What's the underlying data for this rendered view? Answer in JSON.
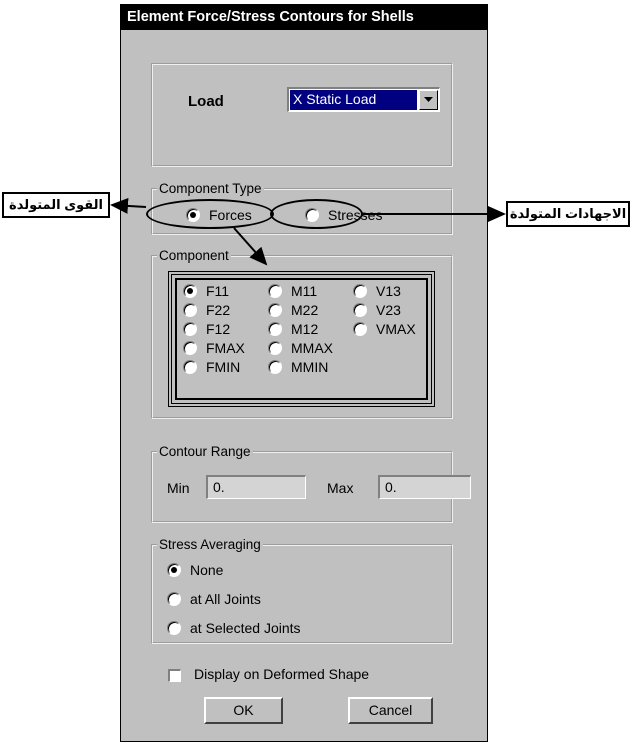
{
  "window": {
    "title": "Element Force/Stress Contours for Shells"
  },
  "load": {
    "label": "Load",
    "selected": "X Static Load"
  },
  "component_type": {
    "legend": "Component Type",
    "options": [
      {
        "label": "Forces",
        "checked": true
      },
      {
        "label": "Stresses",
        "checked": false
      }
    ]
  },
  "component": {
    "legend": "Component",
    "options": [
      {
        "label": "F11",
        "checked": true
      },
      {
        "label": "F22",
        "checked": false
      },
      {
        "label": "F12",
        "checked": false
      },
      {
        "label": "FMAX",
        "checked": false
      },
      {
        "label": "FMIN",
        "checked": false
      },
      {
        "label": "M11",
        "checked": false
      },
      {
        "label": "M22",
        "checked": false
      },
      {
        "label": "M12",
        "checked": false
      },
      {
        "label": "MMAX",
        "checked": false
      },
      {
        "label": "MMIN",
        "checked": false
      },
      {
        "label": "V13",
        "checked": false
      },
      {
        "label": "V23",
        "checked": false
      },
      {
        "label": "VMAX",
        "checked": false
      }
    ]
  },
  "contour_range": {
    "legend": "Contour Range",
    "min_label": "Min",
    "min_value": "0.",
    "max_label": "Max",
    "max_value": "0."
  },
  "stress_averaging": {
    "legend": "Stress Averaging",
    "options": [
      {
        "label": "None",
        "checked": true
      },
      {
        "label": "at All Joints",
        "checked": false
      },
      {
        "label": "at Selected Joints",
        "checked": false
      }
    ]
  },
  "display_deformed": {
    "label": "Display on Deformed Shape",
    "checked": false
  },
  "buttons": {
    "ok": "OK",
    "cancel": "Cancel"
  },
  "annotations": {
    "forces_callout": "القوى المتولدة",
    "stresses_callout": "الاجهادات المتولدة"
  }
}
